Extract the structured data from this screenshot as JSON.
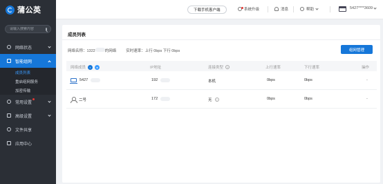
{
  "app": {
    "name": "蒲公英",
    "brand_color": "#1677d9"
  },
  "sidebar": {
    "search_placeholder": "请输入搜索内容",
    "items": [
      {
        "label": "网络状态",
        "icon": "network-icon"
      },
      {
        "label": "智能组网",
        "icon": "grid-icon",
        "active": true
      },
      {
        "label": "常用设置",
        "icon": "gear-icon",
        "has_dot": true
      },
      {
        "label": "高级设置",
        "icon": "settings-icon"
      },
      {
        "label": "文件共享",
        "icon": "share-icon"
      },
      {
        "label": "应用中心",
        "icon": "app-icon"
      }
    ],
    "sub_items": [
      {
        "label": "成员列表",
        "active": true
      },
      {
        "label": "重启组网服务"
      },
      {
        "label": "加密传输"
      }
    ]
  },
  "topbar": {
    "download_label": "下载手机客户端",
    "upgrade_label": "系统升级",
    "message_label": "消息",
    "help_label": "帮助",
    "user_label": "5427****3609"
  },
  "main": {
    "title": "成员列表",
    "network_name": "网络名称：1322",
    "network_name_suffix": "的网络",
    "realtime_rate": "实时速率：上行 0bps 下行 0bps",
    "manage_button": "组网管理",
    "columns": [
      "网络成员",
      "IP地址",
      "连接类型",
      "上行速率",
      "下行速率",
      "操作"
    ],
    "rows": [
      {
        "member": "5427",
        "ip": "192",
        "conn": "本机",
        "up": "0bps",
        "down": "0bps",
        "action": "-",
        "icon": "computer-icon"
      },
      {
        "member": "二号",
        "ip": "172",
        "conn": "无",
        "up": "0bps",
        "down": "0bps",
        "action": "-",
        "icon": "person-icon"
      }
    ]
  }
}
